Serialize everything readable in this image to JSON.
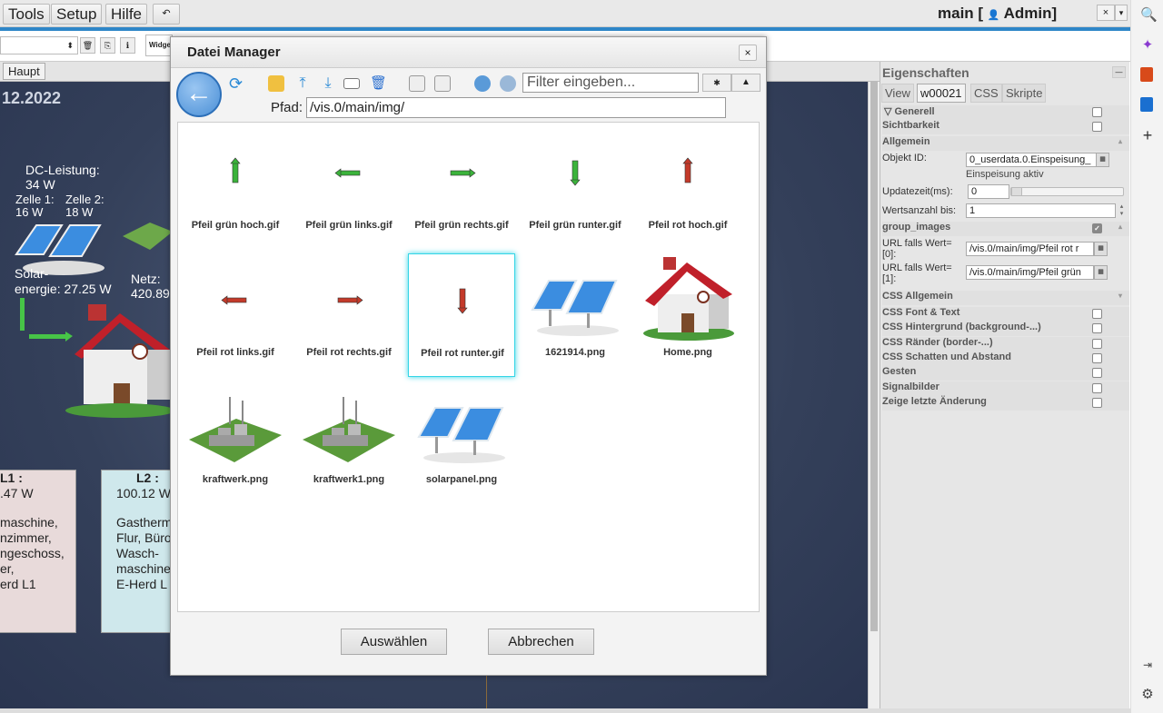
{
  "topbar": {
    "menus": [
      "Tools",
      "Setup",
      "Hilfe"
    ],
    "project": "main [",
    "user": "Admin]"
  },
  "tabbar": {
    "tab": "Haupt"
  },
  "toolbar2": {
    "widget_label": "Widge"
  },
  "canvas": {
    "date": "12.2022",
    "dc_label": "DC-Leistung:",
    "dc_value": "34 W",
    "zelle1_label": "Zelle 1:",
    "zelle1_value": "16 W",
    "zelle2_label": "Zelle 2:",
    "zelle2_value": "18 W",
    "solar_label": "Solar-",
    "solar_value": "energie: 27.25 W",
    "netz_label": "Netz:",
    "netz_value": "420.89",
    "card_l1": {
      "title": "L1 :",
      "value": ".47 W",
      "items": [
        "maschine,",
        "nzimmer,",
        "ngeschoss,",
        "er,",
        "erd L1"
      ]
    },
    "card_l2": {
      "title": "L2 :",
      "value": "100.12 W",
      "items": [
        "Gastherm",
        "Flur, Büro",
        "Wasch-",
        "maschine",
        "E-Herd L"
      ]
    }
  },
  "dialog": {
    "title": "Datei Manager",
    "close": "×",
    "filter_placeholder": "Filter eingeben...",
    "pfad_label": "Pfad:",
    "pfad_value": "/vis.0/main/img/",
    "files": [
      {
        "name": "Pfeil grün hoch.gif",
        "kind": "arrow",
        "dir": "up",
        "color": "#3bb33b"
      },
      {
        "name": "Pfeil grün links.gif",
        "kind": "arrow",
        "dir": "left",
        "color": "#3bb33b"
      },
      {
        "name": "Pfeil grün rechts.gif",
        "kind": "arrow",
        "dir": "right",
        "color": "#3bb33b"
      },
      {
        "name": "Pfeil grün runter.gif",
        "kind": "arrow",
        "dir": "down",
        "color": "#3bb33b"
      },
      {
        "name": "Pfeil rot hoch.gif",
        "kind": "arrow",
        "dir": "up",
        "color": "#c43a2a"
      },
      {
        "name": "Pfeil rot links.gif",
        "kind": "arrow",
        "dir": "left",
        "color": "#c43a2a"
      },
      {
        "name": "Pfeil rot rechts.gif",
        "kind": "arrow",
        "dir": "right",
        "color": "#c43a2a"
      },
      {
        "name": "Pfeil rot runter.gif",
        "kind": "arrow",
        "dir": "down",
        "color": "#c43a2a",
        "selected": true
      },
      {
        "name": "1621914.png",
        "kind": "solar"
      },
      {
        "name": "Home.png",
        "kind": "house"
      },
      {
        "name": "kraftwerk.png",
        "kind": "plant"
      },
      {
        "name": "kraftwerk1.png",
        "kind": "plant"
      },
      {
        "name": "solarpanel.png",
        "kind": "solar"
      }
    ],
    "btn_select": "Auswählen",
    "btn_cancel": "Abbrechen"
  },
  "sidebar": {
    "title": "Eigenschaften",
    "tabs": [
      "View",
      "w00021",
      "CSS",
      "Skripte"
    ],
    "generell": "Generell",
    "sichtbarkeit": "Sichtbarkeit",
    "allgemein": "Allgemein",
    "objekt_id_label": "Objekt ID:",
    "objekt_id_value": "0_userdata.0.Einspeisung_",
    "objekt_id_desc": "Einspeisung aktiv",
    "updatezeit_label": "Updatezeit(ms):",
    "updatezeit_value": "0",
    "wertsanzahl_label": "Wertsanzahl bis:",
    "wertsanzahl_value": "1",
    "group_images": "group_images",
    "url0_label": "URL falls Wert=",
    "url0_index": "[0]:",
    "url0_value": "/vis.0/main/img/Pfeil rot r",
    "url1_label": "URL falls Wert=",
    "url1_index": "[1]:",
    "url1_value": "/vis.0/main/img/Pfeil grün",
    "css_sections": [
      "CSS Allgemein",
      "CSS Font & Text",
      "CSS Hintergrund (background-...)",
      "CSS Ränder (border-...)",
      "CSS Schatten und Abstand",
      "Gesten",
      "Signalbilder",
      "Zeige letzte Änderung"
    ]
  }
}
